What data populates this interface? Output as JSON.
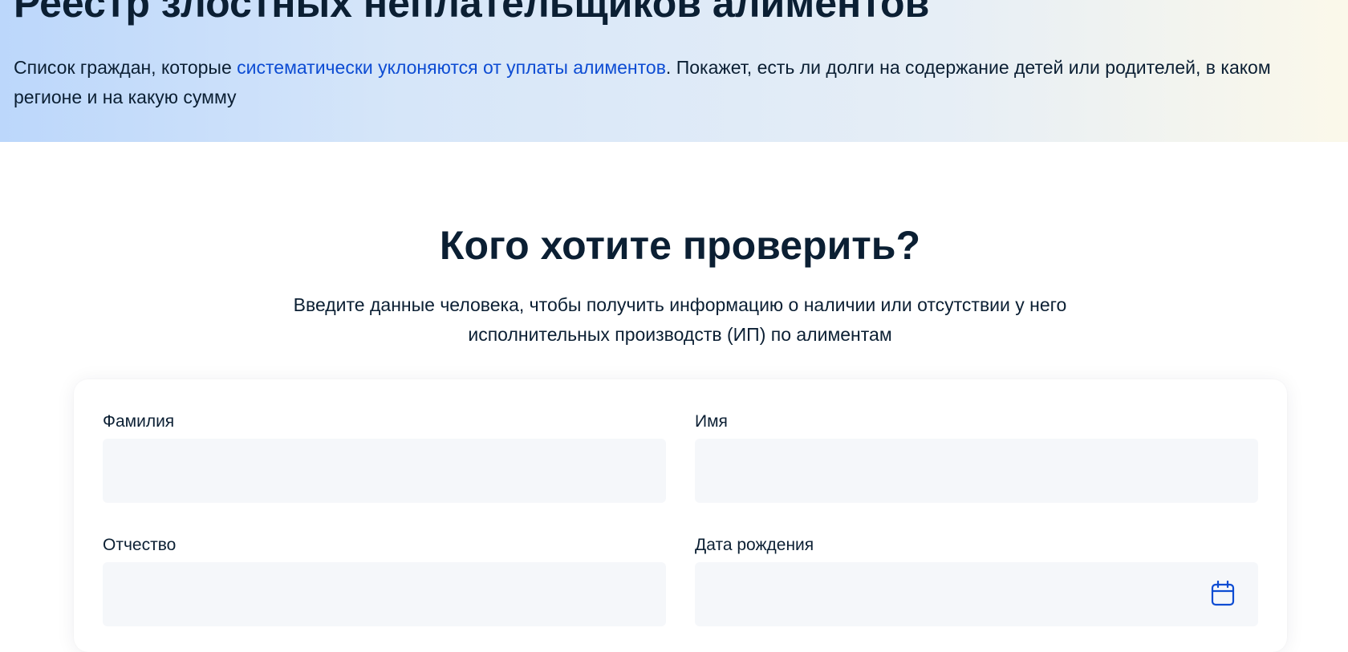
{
  "header": {
    "title": "Реестр злостных неплательщиков алиментов",
    "description_before_link": "Список граждан, которые ",
    "description_link": "систематически уклоняются от уплаты алиментов",
    "description_after_link": ". Покажет, есть ли долги на содержание детей или родителей, в каком регионе и на какую сумму"
  },
  "search": {
    "title": "Кого хотите проверить?",
    "subtitle": "Введите данные человека, чтобы получить информацию о наличии или отсутствии у него исполнительных производств (ИП) по алиментам"
  },
  "form": {
    "last_name": {
      "label": "Фамилия",
      "value": "",
      "placeholder": ""
    },
    "first_name": {
      "label": "Имя",
      "value": "",
      "placeholder": ""
    },
    "middle_name": {
      "label": "Отчество",
      "value": "",
      "placeholder": ""
    },
    "birth_date": {
      "label": "Дата рождения",
      "value": "",
      "placeholder": "",
      "icon": "calendar-icon"
    }
  },
  "colors": {
    "text": "#0b1f33",
    "link": "#0d4cd3",
    "input_bg": "#f5f7fa",
    "icon": "#0d4cd3"
  }
}
